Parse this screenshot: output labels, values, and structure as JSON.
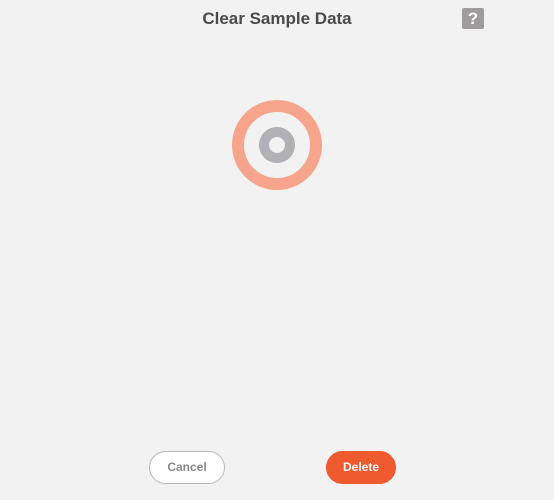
{
  "dialog": {
    "title": "Clear Sample Data",
    "help_label": "?"
  },
  "spinner": {
    "icon": "loading-spinner-icon",
    "outer_ring_color": "#f6a58c",
    "inner_ring_color": "#b2b0b7",
    "background_color": "#f3f2f3"
  },
  "footer": {
    "cancel_label": "Cancel",
    "delete_label": "Delete"
  },
  "colors": {
    "accent": "#ef5a2e",
    "help_button": "#9e9c9d",
    "title_text": "#4a4a4a"
  }
}
